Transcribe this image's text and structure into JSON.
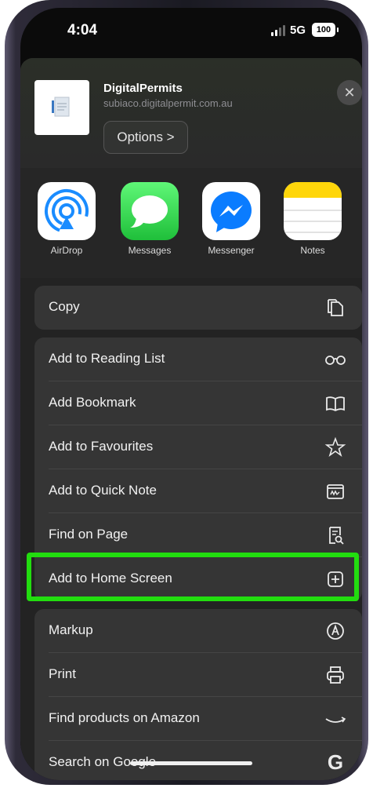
{
  "status": {
    "time": "4:04",
    "network": "5G",
    "battery": "100"
  },
  "share_header": {
    "title": "DigitalPermits",
    "url": "subiaco.digitalpermit.com.au",
    "options_label": "Options >",
    "close_label": "✕"
  },
  "apps": [
    {
      "label": "AirDrop",
      "icon": "airdrop-icon",
      "color": "#1a8cff"
    },
    {
      "label": "Messages",
      "icon": "messages-icon",
      "color": "#34c759"
    },
    {
      "label": "Messenger",
      "icon": "messenger-icon",
      "color": "#0a7cff"
    },
    {
      "label": "Notes",
      "icon": "notes-icon",
      "color": "#ffd60a"
    }
  ],
  "actions": {
    "copy": "Copy",
    "reading_list": "Add to Reading List",
    "bookmark": "Add Bookmark",
    "favourites": "Add to Favourites",
    "quick_note": "Add to Quick Note",
    "find": "Find on Page",
    "home_screen": "Add to Home Screen",
    "markup": "Markup",
    "print": "Print",
    "amazon": "Find products on Amazon",
    "google": "Search on Google",
    "google_glyph": "G"
  },
  "highlight_color": "#22dd0f"
}
